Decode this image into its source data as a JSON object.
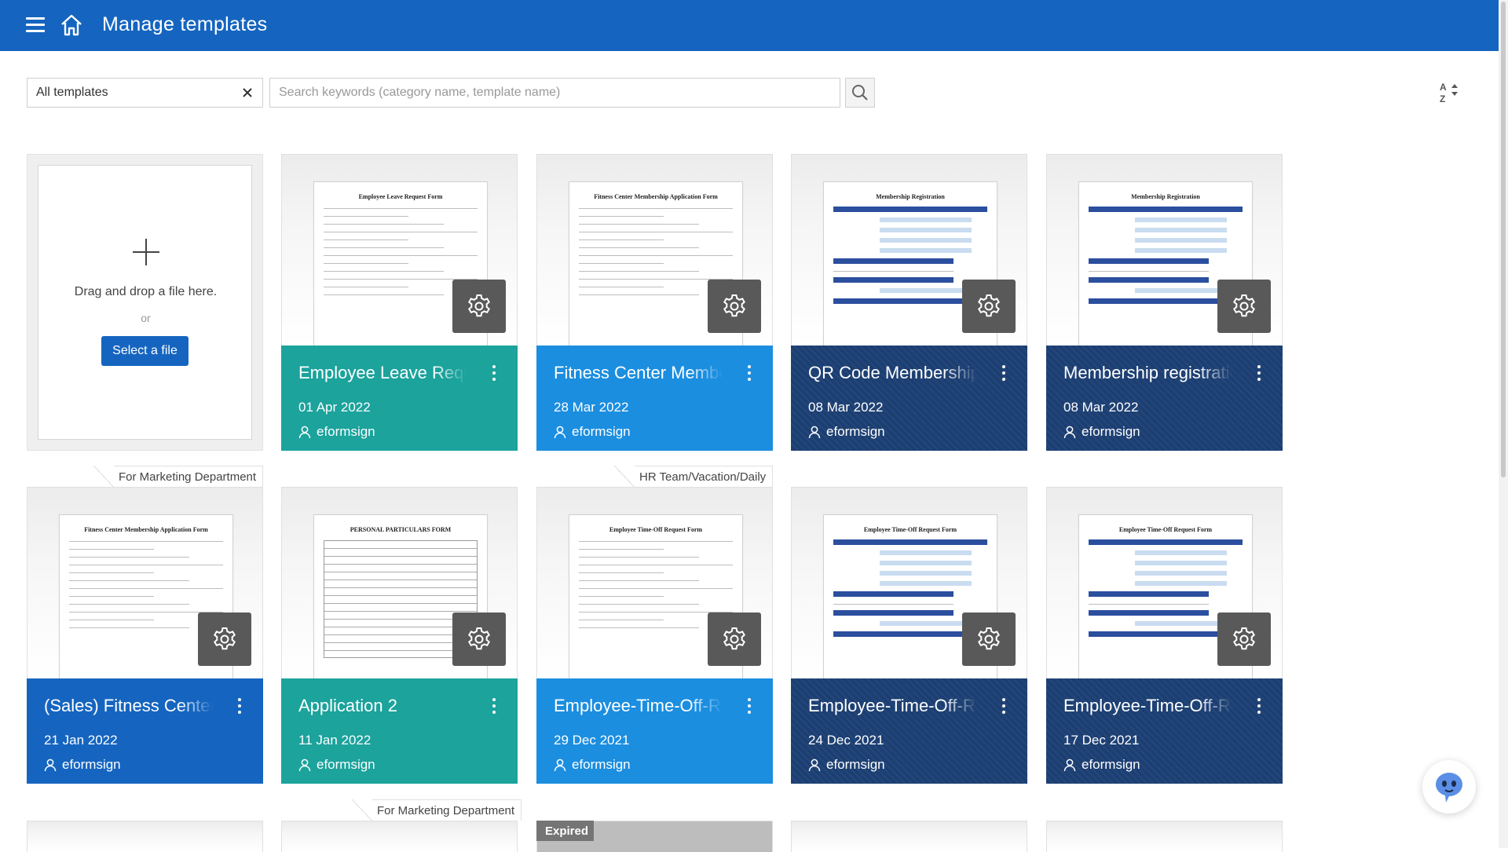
{
  "header": {
    "title": "Manage templates"
  },
  "toolbar": {
    "filter_value": "All templates",
    "search_placeholder": "Search keywords (category name, template name)"
  },
  "upload": {
    "drop_text": "Drag and drop a file here.",
    "or_text": "or",
    "select_label": "Select a file"
  },
  "cards": [
    {
      "title": "Employee Leave Request Form",
      "date": "01 Apr 2022",
      "author": "eformsign",
      "color": "teal",
      "doc_title": "Employee Leave Request Form"
    },
    {
      "title": "Fitness Center Membership Application Form",
      "date": "28 Mar 2022",
      "author": "eformsign",
      "color": "sky",
      "doc_title": "Fitness Center Membership Application Form"
    },
    {
      "title": "QR Code Membership Registration",
      "date": "08 Mar 2022",
      "author": "eformsign",
      "color": "navy",
      "doc_title": "Membership Registration"
    },
    {
      "title": "Membership registration",
      "date": "08 Mar 2022",
      "author": "eformsign",
      "color": "navy",
      "doc_title": "Membership Registration"
    },
    {
      "title": "(Sales) Fitness Center Membership",
      "date": "21 Jan 2022",
      "author": "eformsign",
      "color": "blue",
      "category": "For Marketing Department",
      "doc_title": "Fitness Center Membership Application Form"
    },
    {
      "title": "Application 2",
      "date": "11 Jan 2022",
      "author": "eformsign",
      "color": "teal",
      "doc_title": "PERSONAL PARTICULARS FORM"
    },
    {
      "title": "Employee-Time-Off-Request",
      "date": "29 Dec 2021",
      "author": "eformsign",
      "color": "sky",
      "category": "HR Team/Vacation/Daily",
      "doc_title": "Employee Time-Off Request Form"
    },
    {
      "title": "Employee-Time-Off-Request",
      "date": "24 Dec 2021",
      "author": "eformsign",
      "color": "navy",
      "doc_title": "Employee Time-Off Request Form"
    },
    {
      "title": "Employee-Time-Off-Request",
      "date": "17 Dec 2021",
      "author": "eformsign",
      "color": "navy",
      "doc_title": "Employee Time-Off Request Form"
    }
  ],
  "row3": {
    "category": "For Marketing Department",
    "expired_label": "Expired"
  },
  "colors": {
    "header": "#1565c0",
    "teal": "#1ba39c",
    "sky": "#1b8ee0",
    "navy": "#1c3f73",
    "blue": "#1565c0"
  }
}
